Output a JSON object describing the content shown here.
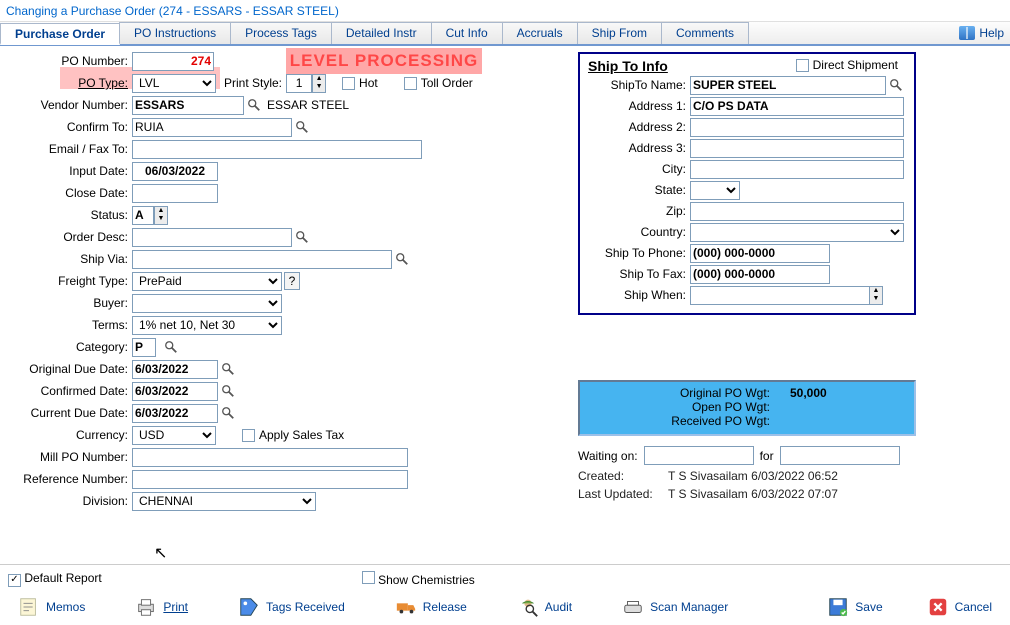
{
  "window_title": "Changing a Purchase Order  (274 - ESSARS -  ESSAR STEEL)",
  "tabs": [
    "Purchase Order",
    "PO Instructions",
    "Process Tags",
    "Detailed Instr",
    "Cut Info",
    "Accruals",
    "Ship From",
    "Comments"
  ],
  "help_label": "Help",
  "banner": "LEVEL PROCESSING",
  "labels": {
    "po_number": "PO Number:",
    "po_type": "PO Type:",
    "print_style": "Print Style:",
    "hot": "Hot",
    "toll_order": "Toll Order",
    "vendor_number": "Vendor Number:",
    "confirm_to": "Confirm To:",
    "email_fax": "Email / Fax To:",
    "input_date": "Input Date:",
    "close_date": "Close Date:",
    "status": "Status:",
    "order_desc": "Order Desc:",
    "ship_via": "Ship Via:",
    "freight_type": "Freight Type:",
    "buyer": "Buyer:",
    "terms": "Terms:",
    "category": "Category:",
    "orig_due": "Original Due Date:",
    "conf_date": "Confirmed Date:",
    "cur_due": "Current Due Date:",
    "currency": "Currency:",
    "apply_tax": "Apply Sales Tax",
    "mill_po": "Mill PO Number:",
    "ref_num": "Reference Number:",
    "division": "Division:"
  },
  "values": {
    "po_number": "274",
    "po_type": "LVL",
    "print_style": "1",
    "vendor_number": "ESSARS",
    "vendor_name": "ESSAR STEEL",
    "confirm_to": "RUIA",
    "input_date": "06/03/2022",
    "status": "A",
    "freight_type": "PrePaid",
    "terms": "1% net 10, Net 30",
    "category": "P",
    "orig_due": "6/03/2022",
    "conf_date": "6/03/2022",
    "cur_due": "6/03/2022",
    "currency": "USD",
    "division": "CHENNAI"
  },
  "shipto": {
    "title": "Ship To Info",
    "direct": "Direct Shipment",
    "labels": {
      "name": "ShipTo Name:",
      "addr1": "Address 1:",
      "addr2": "Address 2:",
      "addr3": "Address 3:",
      "city": "City:",
      "state": "State:",
      "zip": "Zip:",
      "country": "Country:",
      "phone": "Ship To Phone:",
      "fax": "Ship To Fax:",
      "when": "Ship When:"
    },
    "values": {
      "name": "SUPER STEEL",
      "addr1": "C/O PS DATA",
      "phone": "(000) 000-0000",
      "fax": "(000) 000-0000"
    }
  },
  "wgt": {
    "orig_lbl": "Original PO Wgt:",
    "orig_val": "50,000",
    "open_lbl": "Open PO Wgt:",
    "recv_lbl": "Received PO Wgt:"
  },
  "waiting": {
    "on": "Waiting on:",
    "for": "for"
  },
  "meta": {
    "created_lbl": "Created:",
    "created_val": "T S Sivasailam 6/03/2022 06:52",
    "updated_lbl": "Last Updated:",
    "updated_val": "T S Sivasailam 6/03/2022 07:07"
  },
  "footer": {
    "default_report": "Default Report",
    "show_chem": "Show Chemistries",
    "memos": "Memos",
    "print": "Print",
    "tags": "Tags Received",
    "release": "Release",
    "audit": "Audit",
    "scan": "Scan Manager",
    "save": "Save",
    "cancel": "Cancel"
  }
}
